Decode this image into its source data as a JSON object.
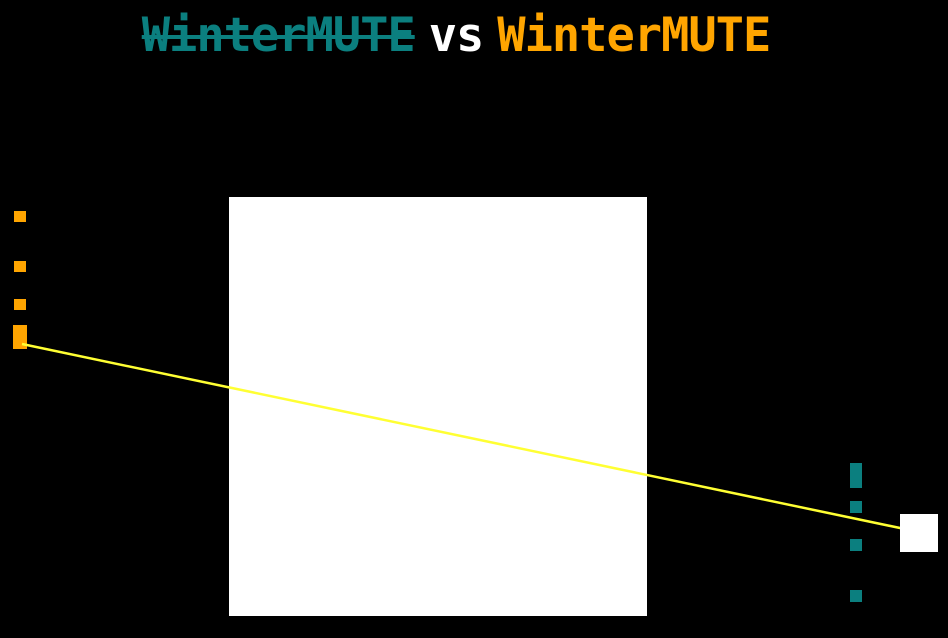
{
  "title": {
    "player_left": "WinterMUTE",
    "vs": "vs",
    "player_right": "WinterMUTE"
  },
  "colors": {
    "background": "#000000",
    "player_left": "#0b7f7f",
    "vs": "#ffffff",
    "player_right": "#ffa500",
    "trajectory": "#ffff33",
    "paddle": "#ffffff",
    "ball": "#ffffff"
  }
}
